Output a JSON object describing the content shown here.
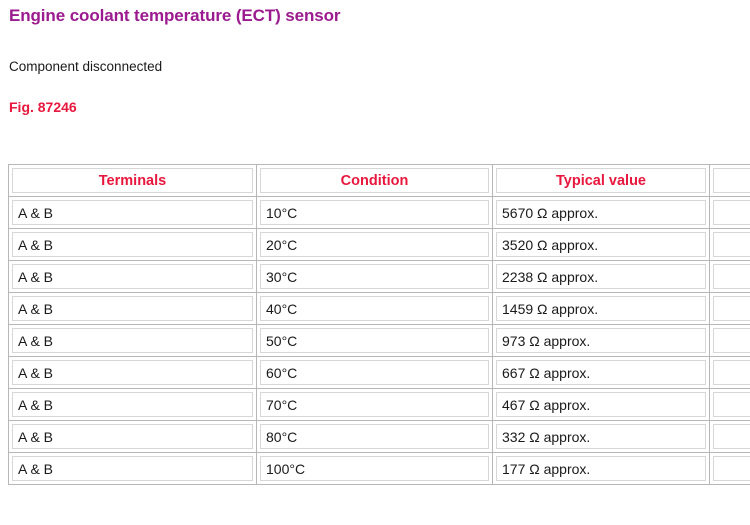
{
  "document": {
    "title": "Engine coolant temperature (ECT) sensor",
    "subtitle": "Component disconnected",
    "figure_label": "Fig. 87246"
  },
  "colors": {
    "title": "#9b1a8f",
    "figure_label": "#e8173d",
    "table_header": "#e8173d",
    "body_text": "#1a1a1a",
    "cell_border": "#d7d7d7",
    "grid_border": "#b7b7b7"
  },
  "table": {
    "headers": [
      "Terminals",
      "Condition",
      "Typical value",
      "",
      ""
    ],
    "rows": [
      {
        "terminals": "A & B",
        "condition": "10°C",
        "typical_value": "5670 Ω approx.",
        "extra1": "",
        "extra2": ""
      },
      {
        "terminals": "A & B",
        "condition": "20°C",
        "typical_value": "3520 Ω approx.",
        "extra1": "",
        "extra2": ""
      },
      {
        "terminals": "A & B",
        "condition": "30°C",
        "typical_value": "2238 Ω approx.",
        "extra1": "",
        "extra2": ""
      },
      {
        "terminals": "A & B",
        "condition": "40°C",
        "typical_value": "1459 Ω approx.",
        "extra1": "",
        "extra2": ""
      },
      {
        "terminals": "A & B",
        "condition": "50°C",
        "typical_value": "973 Ω approx.",
        "extra1": "",
        "extra2": ""
      },
      {
        "terminals": "A & B",
        "condition": "60°C",
        "typical_value": "667 Ω approx.",
        "extra1": "",
        "extra2": ""
      },
      {
        "terminals": "A & B",
        "condition": "70°C",
        "typical_value": "467 Ω approx.",
        "extra1": "",
        "extra2": ""
      },
      {
        "terminals": "A & B",
        "condition": "80°C",
        "typical_value": "332 Ω approx.",
        "extra1": "",
        "extra2": ""
      },
      {
        "terminals": "A & B",
        "condition": "100°C",
        "typical_value": "177 Ω approx.",
        "extra1": "",
        "extra2": ""
      }
    ]
  }
}
